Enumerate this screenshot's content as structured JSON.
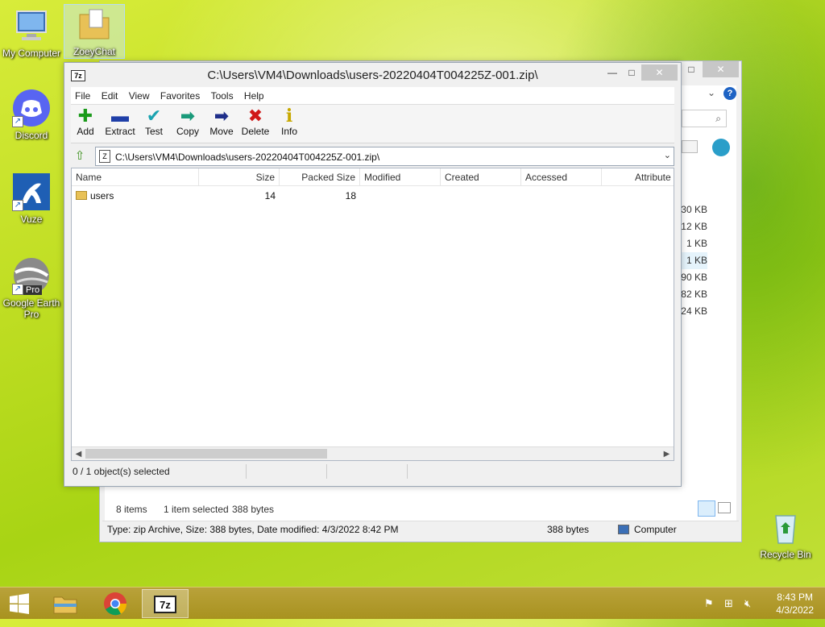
{
  "desktop": {
    "icons": [
      {
        "label": "My Computer"
      },
      {
        "label": "ZoeyChat"
      },
      {
        "label": "Discord"
      },
      {
        "label": "Vuze"
      },
      {
        "label": "Google Earth Pro"
      },
      {
        "label": "Recycle Bin"
      }
    ],
    "shortcut_badge": "Pro"
  },
  "explorer_bg": {
    "sizes": [
      "30 KB",
      "12 KB",
      "1 KB",
      "1 KB",
      "90 KB",
      "82 KB",
      "24 KB"
    ],
    "status": {
      "items": "8 items",
      "selected": "1 item selected",
      "bytes": "388 bytes"
    },
    "details": {
      "info": "Type: zip Archive, Size: 388 bytes, Date modified: 4/3/2022 8:42 PM",
      "size": "388 bytes",
      "location": "Computer"
    }
  },
  "sevenzip": {
    "title": "C:\\Users\\VM4\\Downloads\\users-20220404T004225Z-001.zip\\",
    "logo": "7z",
    "menu": [
      "File",
      "Edit",
      "View",
      "Favorites",
      "Tools",
      "Help"
    ],
    "toolbar": [
      {
        "label": "Add",
        "glyph": "✚"
      },
      {
        "label": "Extract",
        "glyph": "▬"
      },
      {
        "label": "Test",
        "glyph": "✔"
      },
      {
        "label": "Copy",
        "glyph": "➡"
      },
      {
        "label": "Move",
        "glyph": "➡"
      },
      {
        "label": "Delete",
        "glyph": "✖"
      },
      {
        "label": "Info",
        "glyph": "i"
      }
    ],
    "address": "C:\\Users\\VM4\\Downloads\\users-20220404T004225Z-001.zip\\",
    "columns": [
      "Name",
      "Size",
      "Packed Size",
      "Modified",
      "Created",
      "Accessed",
      "Attribute"
    ],
    "rows": [
      {
        "name": "users",
        "size": "14",
        "packed": "18"
      }
    ],
    "status": "0 / 1 object(s) selected"
  },
  "taskbar": {
    "time": "8:43 PM",
    "date": "4/3/2022",
    "apps": [
      {
        "label": "",
        "glyph": "🗂"
      },
      {
        "label": "",
        "glyph": "◎"
      },
      {
        "label": "7z",
        "glyph": "7z"
      }
    ]
  },
  "colors": {
    "accent": "#1e63c4",
    "taskbar": "#a8921f",
    "delete": "#d01818",
    "add": "#1a9a1a"
  }
}
